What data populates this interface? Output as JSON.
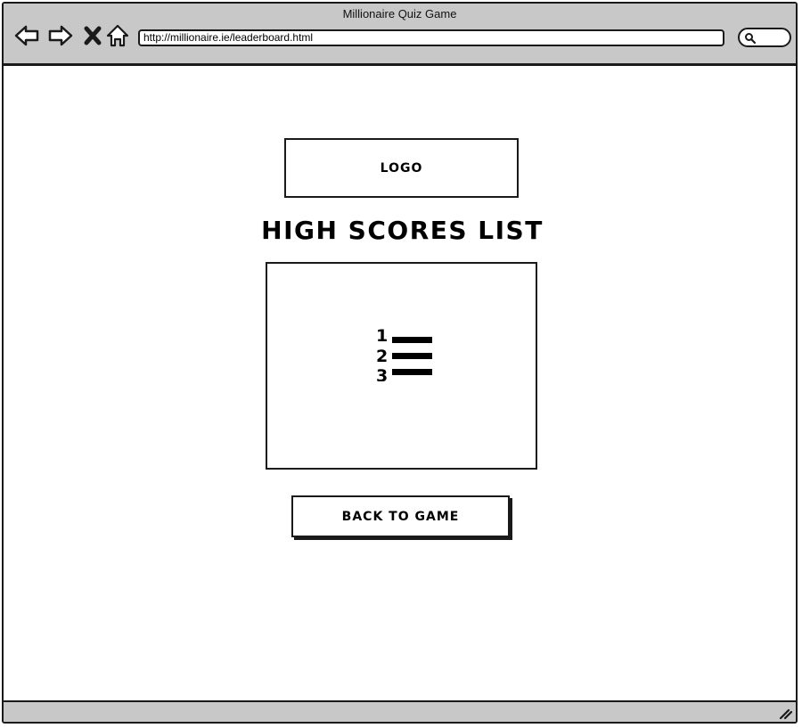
{
  "window": {
    "title": "Millionaire Quiz Game"
  },
  "toolbar": {
    "back_icon": "arrow-left-icon",
    "forward_icon": "arrow-right-icon",
    "stop_icon": "close-icon",
    "home_icon": "home-icon",
    "url": "http://millionaire.ie/leaderboard.html",
    "search_icon": "search-icon"
  },
  "page": {
    "logo_label": "LOGO",
    "heading": "HIGH SCORES LIST",
    "list_icon": "numbered-list-icon",
    "list_numbers": [
      "1",
      "2",
      "3"
    ],
    "back_button_label": "BACK TO GAME"
  },
  "colors": {
    "chrome": "#c8c8c8",
    "border": "#1a1a1a",
    "background": "#ffffff"
  }
}
